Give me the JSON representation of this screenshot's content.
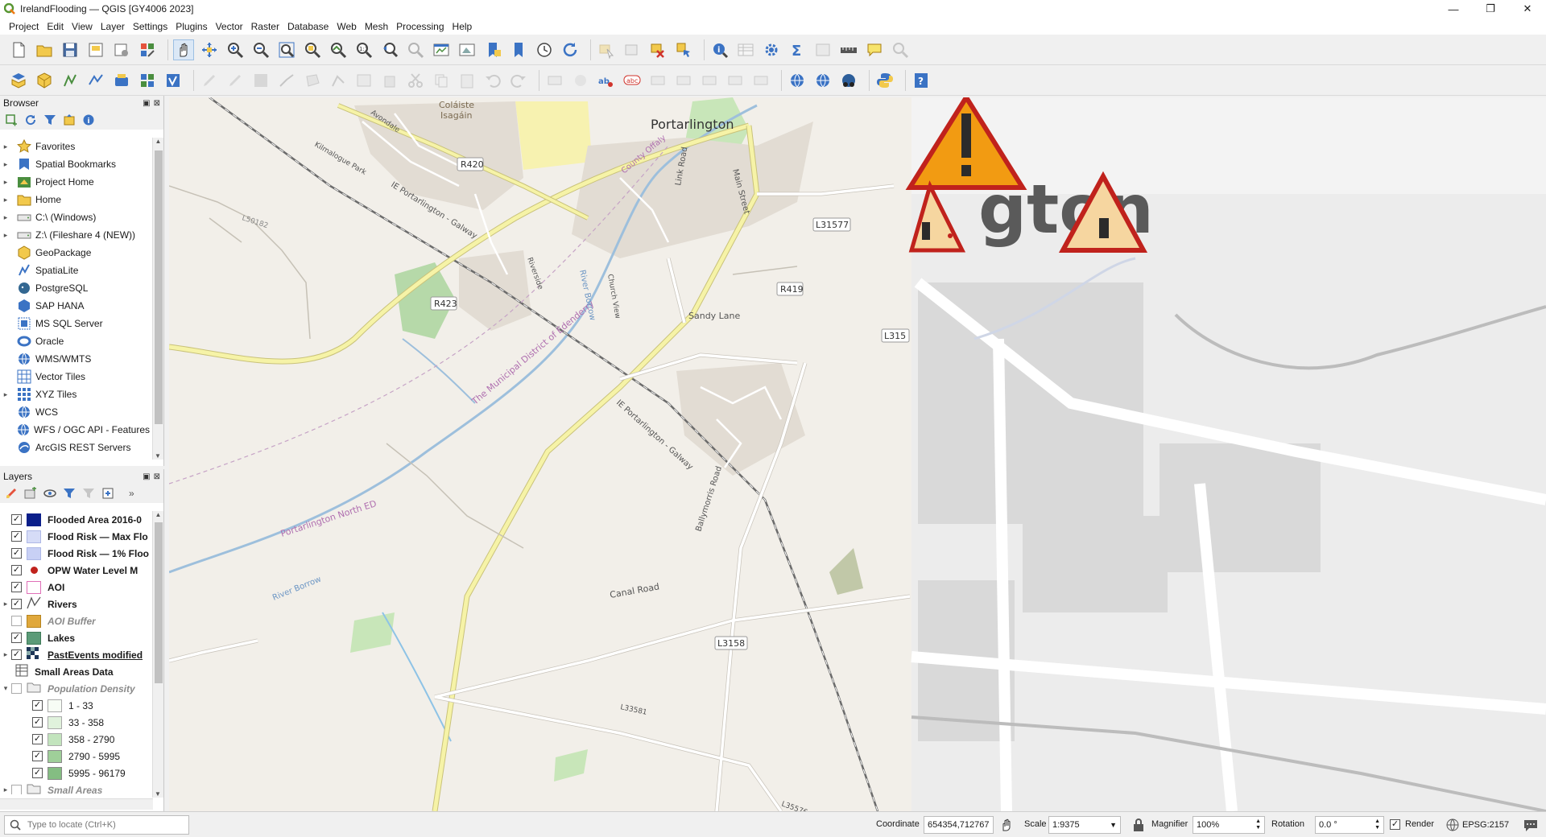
{
  "window": {
    "title": "IrelandFlooding — QGIS [GY4006 2023]",
    "min": "—",
    "max": "❐",
    "close": "✕"
  },
  "menu": [
    "Project",
    "Edit",
    "View",
    "Layer",
    "Settings",
    "Plugins",
    "Vector",
    "Raster",
    "Database",
    "Web",
    "Mesh",
    "Processing",
    "Help"
  ],
  "browser": {
    "title": "Browser",
    "items": [
      {
        "label": "Favorites",
        "icon": "star-icon"
      },
      {
        "label": "Spatial Bookmarks",
        "icon": "bookmark-icon"
      },
      {
        "label": "Project Home",
        "icon": "project-home-icon"
      },
      {
        "label": "Home",
        "icon": "folder-icon"
      },
      {
        "label": "C:\\ (Windows)",
        "icon": "drive-icon"
      },
      {
        "label": "Z:\\ (Fileshare 4 (NEW))",
        "icon": "drive-icon"
      },
      {
        "label": "GeoPackage",
        "icon": "geopackage-icon"
      },
      {
        "label": "SpatiaLite",
        "icon": "spatialite-icon"
      },
      {
        "label": "PostgreSQL",
        "icon": "postgresql-icon"
      },
      {
        "label": "SAP HANA",
        "icon": "sap-hana-icon"
      },
      {
        "label": "MS SQL Server",
        "icon": "mssql-icon"
      },
      {
        "label": "Oracle",
        "icon": "oracle-icon"
      },
      {
        "label": "WMS/WMTS",
        "icon": "wms-icon"
      },
      {
        "label": "Vector Tiles",
        "icon": "vector-tiles-icon"
      },
      {
        "label": "XYZ Tiles",
        "icon": "xyz-tiles-icon"
      },
      {
        "label": "WCS",
        "icon": "wcs-icon"
      },
      {
        "label": "WFS / OGC API - Features",
        "icon": "wfs-icon"
      },
      {
        "label": "ArcGIS REST Servers",
        "icon": "arcgis-icon"
      }
    ]
  },
  "layers": {
    "title": "Layers",
    "items": [
      {
        "label": "Flooded Area 2016-0",
        "swatch": "#0b1f8a",
        "checked": true,
        "style": "bold"
      },
      {
        "label": "Flood Risk — Max Flo",
        "swatch": "#d6dcf7",
        "checked": true,
        "style": "bold"
      },
      {
        "label": "Flood Risk — 1% Floo",
        "swatch": "#c8d0f5",
        "checked": true,
        "style": "bold"
      },
      {
        "label": "OPW Water Level M",
        "swatch": "dot",
        "checked": true,
        "style": "bold"
      },
      {
        "label": "AOI",
        "swatch": "#fbe9f4",
        "checked": true,
        "style": "bold"
      },
      {
        "label": "Rivers",
        "swatch": "line",
        "checked": true,
        "style": "bold"
      },
      {
        "label": "AOI Buffer",
        "swatch": "#e0a83c",
        "checked": false,
        "style": "ital"
      },
      {
        "label": "Lakes",
        "swatch": "#5b9b78",
        "checked": true,
        "style": "bold"
      },
      {
        "label": "PastEvents modified",
        "swatch": "raster",
        "checked": true,
        "style": "bold"
      },
      {
        "label": "Small Areas Data",
        "swatch": "table",
        "checked": null,
        "style": "bold"
      },
      {
        "label": "Population Density",
        "swatch": "group",
        "checked": false,
        "style": "ital"
      },
      {
        "label": "1 - 33",
        "swatch": "#f7fcf5",
        "checked": true,
        "style": "norm"
      },
      {
        "label": "33 - 358",
        "swatch": "#e0f2dc",
        "checked": true,
        "style": "norm"
      },
      {
        "label": "358 - 2790",
        "swatch": "#c2e4bd",
        "checked": true,
        "style": "norm"
      },
      {
        "label": "2790 - 5995",
        "swatch": "#9fcf99",
        "checked": true,
        "style": "norm"
      },
      {
        "label": "5995 - 96179",
        "swatch": "#84bd82",
        "checked": true,
        "style": "norm"
      },
      {
        "label": "Small Areas",
        "swatch": "group",
        "checked": false,
        "style": "ital"
      }
    ]
  },
  "map": {
    "labels": {
      "portarlington": "Portarlington",
      "coldiste": "Coláiste",
      "isagain": "Isagáin",
      "r420": "R420",
      "r423": "R423",
      "r419": "R419",
      "l31577": "L31577",
      "l3158": "L3158",
      "l50182": "L50182",
      "canal_road": "Canal Road",
      "sandy_lane": "Sandy Lane",
      "link_road": "Link Road",
      "district": "The Municipal District of Edenderry",
      "north_ed": "Portarlington North ED",
      "river_borrow": "River Borrow",
      "river_borrow2": "River Borrow",
      "county_offaly": "County Offaly",
      "ie_portarlington": "IE Portarlington - Galway",
      "ie_portarlington2": "IE Portarlington - Galway",
      "ballymorris": "Ballymorris Road",
      "main_street": "Main Street",
      "zoom_text": "gton",
      "l315": "L315",
      "l33581": "L33581",
      "l35576": "L35576",
      "avondale": "Avondale",
      "church_view": "Church View",
      "riverside": "Riverside",
      "kilmalogue": "Kilmalogue Park"
    }
  },
  "status": {
    "locate_placeholder": "Type to locate (Ctrl+K)",
    "coordinate_label": "Coordinate",
    "coordinate": "654354,712767",
    "scale_label": "Scale",
    "scale": "1:9375",
    "magnifier_label": "Magnifier",
    "magnifier": "100%",
    "rotation_label": "Rotation",
    "rotation": "0.0 °",
    "render_label": "Render",
    "crs": "EPSG:2157"
  }
}
